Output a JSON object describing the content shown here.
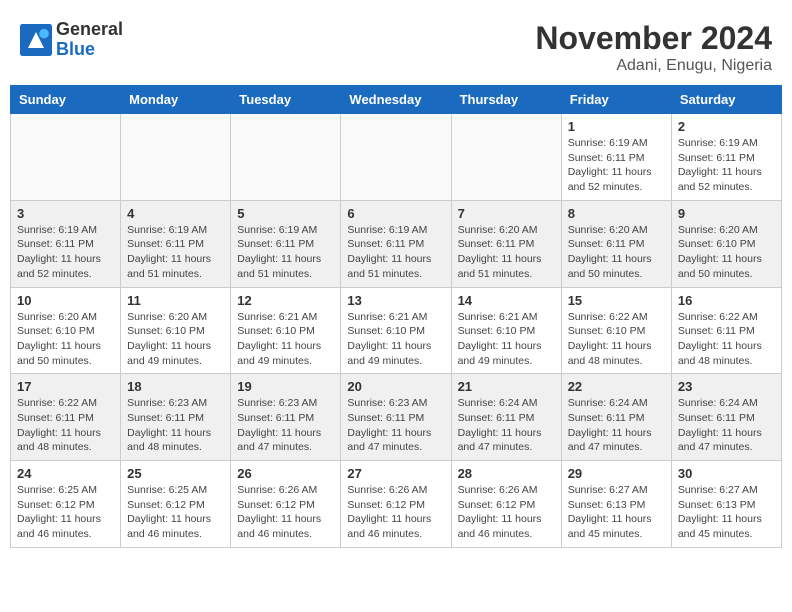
{
  "logo": {
    "general": "General",
    "blue": "Blue"
  },
  "title": "November 2024",
  "location": "Adani, Enugu, Nigeria",
  "days_of_week": [
    "Sunday",
    "Monday",
    "Tuesday",
    "Wednesday",
    "Thursday",
    "Friday",
    "Saturday"
  ],
  "weeks": [
    [
      {
        "day": "",
        "info": ""
      },
      {
        "day": "",
        "info": ""
      },
      {
        "day": "",
        "info": ""
      },
      {
        "day": "",
        "info": ""
      },
      {
        "day": "",
        "info": ""
      },
      {
        "day": "1",
        "info": "Sunrise: 6:19 AM\nSunset: 6:11 PM\nDaylight: 11 hours and 52 minutes."
      },
      {
        "day": "2",
        "info": "Sunrise: 6:19 AM\nSunset: 6:11 PM\nDaylight: 11 hours and 52 minutes."
      }
    ],
    [
      {
        "day": "3",
        "info": "Sunrise: 6:19 AM\nSunset: 6:11 PM\nDaylight: 11 hours and 52 minutes."
      },
      {
        "day": "4",
        "info": "Sunrise: 6:19 AM\nSunset: 6:11 PM\nDaylight: 11 hours and 51 minutes."
      },
      {
        "day": "5",
        "info": "Sunrise: 6:19 AM\nSunset: 6:11 PM\nDaylight: 11 hours and 51 minutes."
      },
      {
        "day": "6",
        "info": "Sunrise: 6:19 AM\nSunset: 6:11 PM\nDaylight: 11 hours and 51 minutes."
      },
      {
        "day": "7",
        "info": "Sunrise: 6:20 AM\nSunset: 6:11 PM\nDaylight: 11 hours and 51 minutes."
      },
      {
        "day": "8",
        "info": "Sunrise: 6:20 AM\nSunset: 6:11 PM\nDaylight: 11 hours and 50 minutes."
      },
      {
        "day": "9",
        "info": "Sunrise: 6:20 AM\nSunset: 6:10 PM\nDaylight: 11 hours and 50 minutes."
      }
    ],
    [
      {
        "day": "10",
        "info": "Sunrise: 6:20 AM\nSunset: 6:10 PM\nDaylight: 11 hours and 50 minutes."
      },
      {
        "day": "11",
        "info": "Sunrise: 6:20 AM\nSunset: 6:10 PM\nDaylight: 11 hours and 49 minutes."
      },
      {
        "day": "12",
        "info": "Sunrise: 6:21 AM\nSunset: 6:10 PM\nDaylight: 11 hours and 49 minutes."
      },
      {
        "day": "13",
        "info": "Sunrise: 6:21 AM\nSunset: 6:10 PM\nDaylight: 11 hours and 49 minutes."
      },
      {
        "day": "14",
        "info": "Sunrise: 6:21 AM\nSunset: 6:10 PM\nDaylight: 11 hours and 49 minutes."
      },
      {
        "day": "15",
        "info": "Sunrise: 6:22 AM\nSunset: 6:10 PM\nDaylight: 11 hours and 48 minutes."
      },
      {
        "day": "16",
        "info": "Sunrise: 6:22 AM\nSunset: 6:11 PM\nDaylight: 11 hours and 48 minutes."
      }
    ],
    [
      {
        "day": "17",
        "info": "Sunrise: 6:22 AM\nSunset: 6:11 PM\nDaylight: 11 hours and 48 minutes."
      },
      {
        "day": "18",
        "info": "Sunrise: 6:23 AM\nSunset: 6:11 PM\nDaylight: 11 hours and 48 minutes."
      },
      {
        "day": "19",
        "info": "Sunrise: 6:23 AM\nSunset: 6:11 PM\nDaylight: 11 hours and 47 minutes."
      },
      {
        "day": "20",
        "info": "Sunrise: 6:23 AM\nSunset: 6:11 PM\nDaylight: 11 hours and 47 minutes."
      },
      {
        "day": "21",
        "info": "Sunrise: 6:24 AM\nSunset: 6:11 PM\nDaylight: 11 hours and 47 minutes."
      },
      {
        "day": "22",
        "info": "Sunrise: 6:24 AM\nSunset: 6:11 PM\nDaylight: 11 hours and 47 minutes."
      },
      {
        "day": "23",
        "info": "Sunrise: 6:24 AM\nSunset: 6:11 PM\nDaylight: 11 hours and 47 minutes."
      }
    ],
    [
      {
        "day": "24",
        "info": "Sunrise: 6:25 AM\nSunset: 6:12 PM\nDaylight: 11 hours and 46 minutes."
      },
      {
        "day": "25",
        "info": "Sunrise: 6:25 AM\nSunset: 6:12 PM\nDaylight: 11 hours and 46 minutes."
      },
      {
        "day": "26",
        "info": "Sunrise: 6:26 AM\nSunset: 6:12 PM\nDaylight: 11 hours and 46 minutes."
      },
      {
        "day": "27",
        "info": "Sunrise: 6:26 AM\nSunset: 6:12 PM\nDaylight: 11 hours and 46 minutes."
      },
      {
        "day": "28",
        "info": "Sunrise: 6:26 AM\nSunset: 6:12 PM\nDaylight: 11 hours and 46 minutes."
      },
      {
        "day": "29",
        "info": "Sunrise: 6:27 AM\nSunset: 6:13 PM\nDaylight: 11 hours and 45 minutes."
      },
      {
        "day": "30",
        "info": "Sunrise: 6:27 AM\nSunset: 6:13 PM\nDaylight: 11 hours and 45 minutes."
      }
    ]
  ]
}
